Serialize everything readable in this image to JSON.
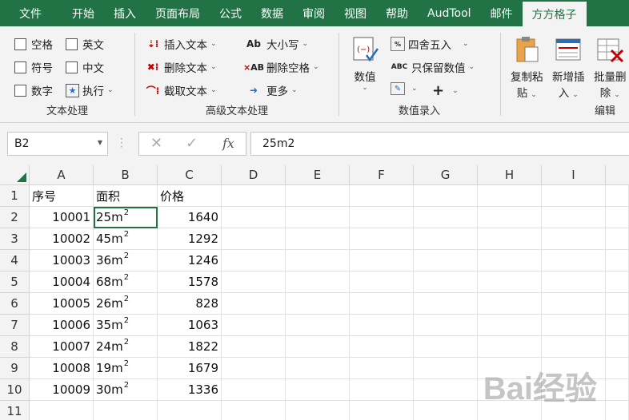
{
  "tabs": [
    "文件",
    "开始",
    "插入",
    "页面布局",
    "公式",
    "数据",
    "审阅",
    "视图",
    "帮助",
    "AudTool",
    "邮件",
    "方方格子"
  ],
  "active_tab": "方方格子",
  "ribbon": {
    "text_group": {
      "label": "文本处理",
      "space": "空格",
      "english": "英文",
      "symbol": "符号",
      "chinese": "中文",
      "digit": "数字",
      "execute": "执行"
    },
    "advanced_group": {
      "label": "高级文本处理",
      "insert_text": "插入文本",
      "delete_text": "删除文本",
      "truncate_text": "截取文本",
      "case": "大小写",
      "delete_space": "删除空格",
      "more": "更多"
    },
    "number_group": {
      "label": "数值录入",
      "value_label": "数值",
      "round": "四舍五入",
      "keep_value": "只保留数值",
      "plus": "+"
    },
    "edit_group": {
      "label": "编辑",
      "copy_paste_1": "复制粘",
      "copy_paste_2": "贴",
      "new_insert_1": "新增插",
      "new_insert_2": "入",
      "batch_delete_1": "批量删",
      "batch_delete_2": "除"
    }
  },
  "formula_bar": {
    "name_box": "B2",
    "cancel": "✕",
    "confirm": "✓",
    "fx": "fx",
    "value": "25m2"
  },
  "sheet": {
    "columns": [
      "A",
      "B",
      "C",
      "D",
      "E",
      "F",
      "G",
      "H",
      "I"
    ],
    "rows": [
      "1",
      "2",
      "3",
      "4",
      "5",
      "6",
      "7",
      "8",
      "9",
      "10",
      "11"
    ],
    "header": [
      "序号",
      "面积",
      "价格"
    ],
    "data": [
      {
        "id": "10001",
        "area": "25m",
        "price": "1640"
      },
      {
        "id": "10002",
        "area": "45m",
        "price": "1292"
      },
      {
        "id": "10003",
        "area": "36m",
        "price": "1246"
      },
      {
        "id": "10004",
        "area": "68m",
        "price": "1578"
      },
      {
        "id": "10005",
        "area": "26m",
        "price": "828"
      },
      {
        "id": "10006",
        "area": "35m",
        "price": "1063"
      },
      {
        "id": "10007",
        "area": "24m",
        "price": "1822"
      },
      {
        "id": "10008",
        "area": "19m",
        "price": "1679"
      },
      {
        "id": "10009",
        "area": "30m",
        "price": "1336"
      }
    ],
    "superscript": "2"
  },
  "watermark": "Bai经验",
  "colors": {
    "accent": "#217346"
  }
}
